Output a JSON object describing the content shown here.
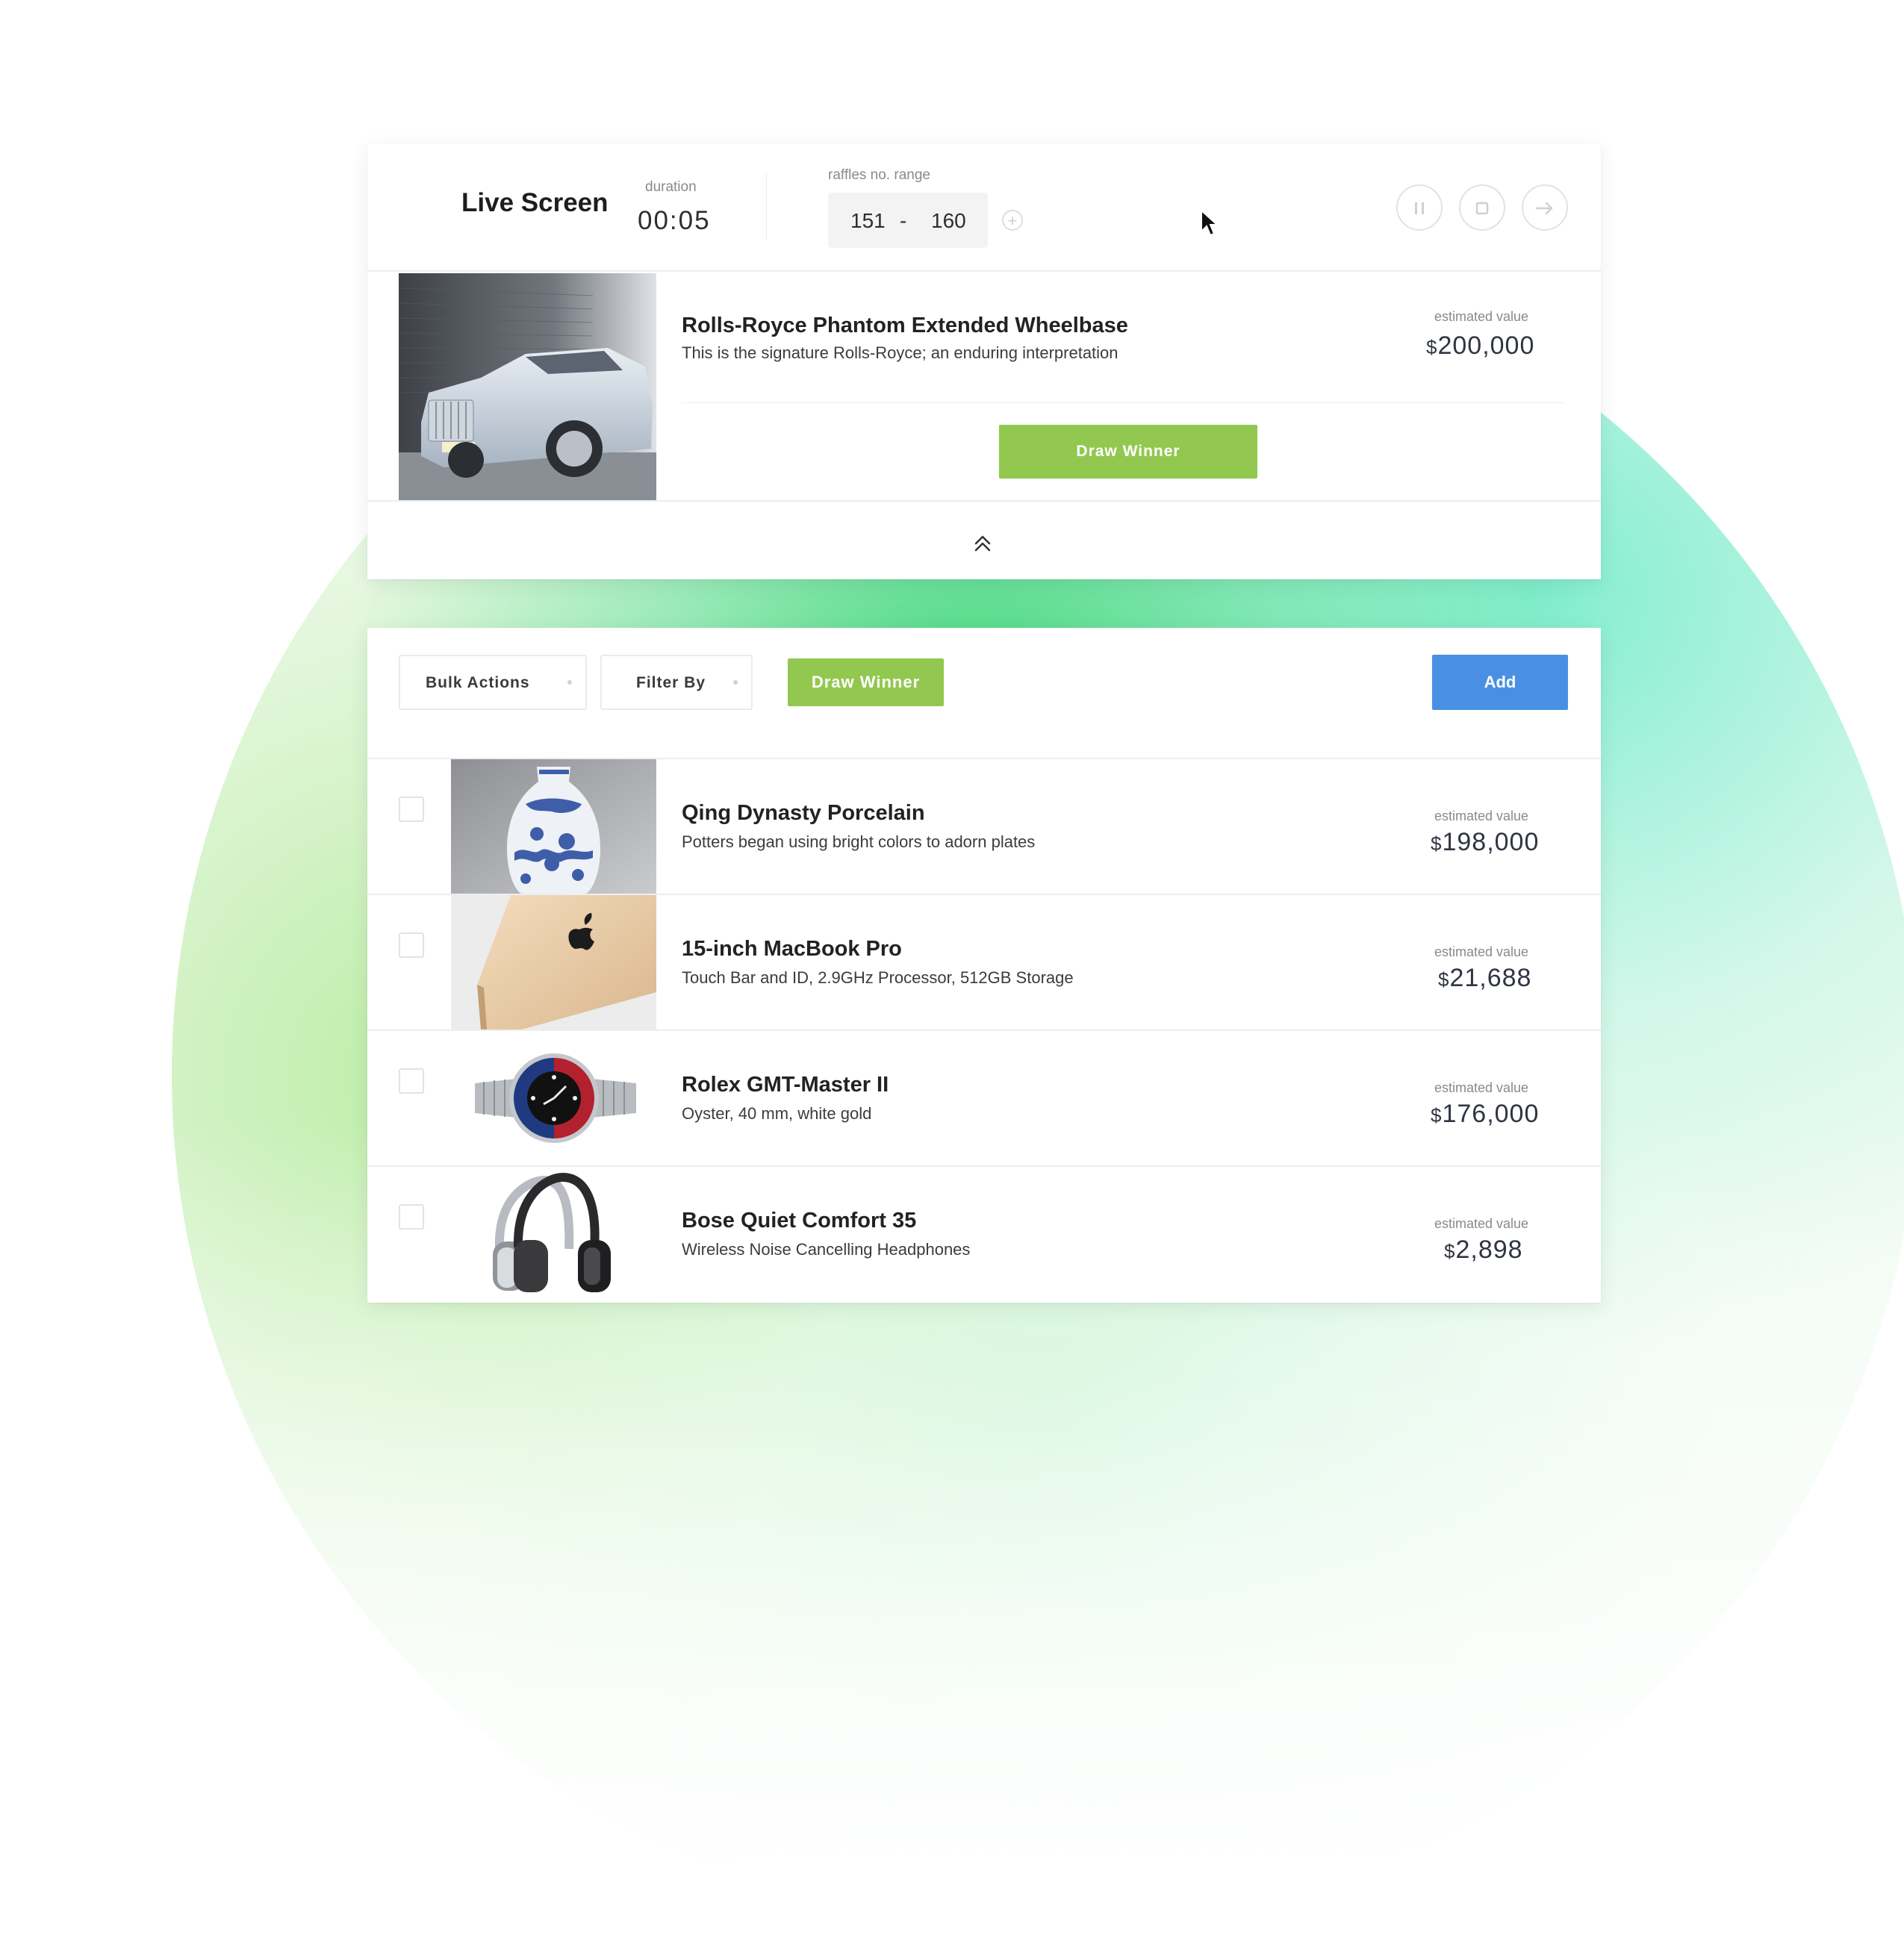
{
  "live": {
    "title": "Live Screen",
    "duration_label": "duration",
    "duration_value": "00:05",
    "range_label": "raffles no. range",
    "range_from": "151",
    "range_sep": "-",
    "range_to": "160",
    "featured": {
      "title": "Rolls-Royce Phantom Extended Wheelbase",
      "description": "This is the signature Rolls-Royce; an enduring interpretation",
      "est_label": "estimated value",
      "currency": "$",
      "value": "200,000",
      "draw_button": "Draw Winner"
    }
  },
  "toolbar": {
    "bulk_actions": "Bulk Actions",
    "filter_by": "Filter By",
    "draw_winner": "Draw Winner",
    "add": "Add"
  },
  "items": [
    {
      "title": "Qing Dynasty Porcelain",
      "description": "Potters began using bright colors to adorn plates",
      "est_label": "estimated value",
      "currency": "$",
      "value": "198,000",
      "image": "porcelain-vase"
    },
    {
      "title": "15-inch MacBook Pro",
      "description": "Touch Bar and ID, 2.9GHz Processor, 512GB Storage",
      "est_label": "estimated value",
      "currency": "$",
      "value": "21,688",
      "image": "macbook"
    },
    {
      "title": "Rolex GMT-Master II",
      "description": "Oyster, 40 mm, white gold",
      "est_label": "estimated value",
      "currency": "$",
      "value": "176,000",
      "image": "watch"
    },
    {
      "title": "Bose Quiet Comfort 35",
      "description": "Wireless Noise Cancelling Headphones",
      "est_label": "estimated value",
      "currency": "$",
      "value": "2,898",
      "image": "headphones"
    }
  ],
  "icons": [
    "pause-icon",
    "stop-icon",
    "arrow-right-icon",
    "plus-icon",
    "chevron-up-double-icon",
    "cursor-icon"
  ],
  "colors": {
    "green": "#92c84f",
    "blue": "#4a90e2"
  }
}
